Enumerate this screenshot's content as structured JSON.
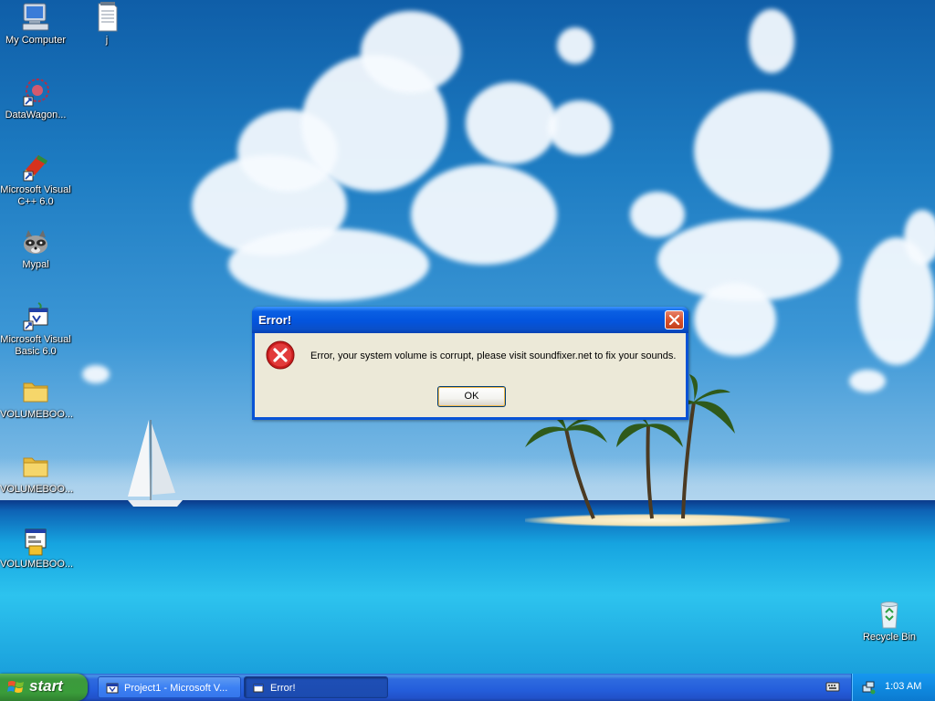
{
  "desktop": {
    "icons": [
      {
        "label": "My Computer",
        "icon": "my-computer-icon"
      },
      {
        "label": "j",
        "icon": "text-document-icon"
      },
      {
        "label": "DataWagon...",
        "icon": "datawagon-shortcut-icon"
      },
      {
        "label": "Microsoft Visual C++ 6.0",
        "icon": "visual-cpp-shortcut-icon"
      },
      {
        "label": "Mypal",
        "icon": "raccoon-browser-icon"
      },
      {
        "label": "Microsoft Visual Basic 6.0",
        "icon": "visual-basic-shortcut-icon"
      },
      {
        "label": "VOLUMEBOO...",
        "icon": "folder-icon"
      },
      {
        "label": "VOLUMEBOO...",
        "icon": "folder-icon"
      },
      {
        "label": "VOLUMEBOO...",
        "icon": "vb-executable-icon"
      },
      {
        "label": "Recycle Bin",
        "icon": "recycle-bin-icon"
      }
    ]
  },
  "dialog": {
    "title": "Error!",
    "message": "Error, your system volume is corrupt, please visit soundfixer.net to fix your sounds.",
    "ok_label": "OK",
    "icon": "error-icon",
    "close_icon": "close-icon"
  },
  "taskbar": {
    "start_label": "start",
    "buttons": [
      {
        "label": "Project1 - Microsoft V...",
        "icon": "visual-basic-icon",
        "active": true
      },
      {
        "label": "Error!",
        "icon": "window-icon",
        "active": false
      }
    ],
    "clock": "1:03 AM",
    "tray_icon": "network-icon",
    "keyboard_icon": "keyboard-icon"
  },
  "colors": {
    "titlebar": "#0354dd",
    "dialog_body": "#ece9d8",
    "start_green": "#3a9c3a",
    "taskbar_blue": "#245edb",
    "tray_blue": "#0f8ae0",
    "error_red": "#d32020"
  }
}
